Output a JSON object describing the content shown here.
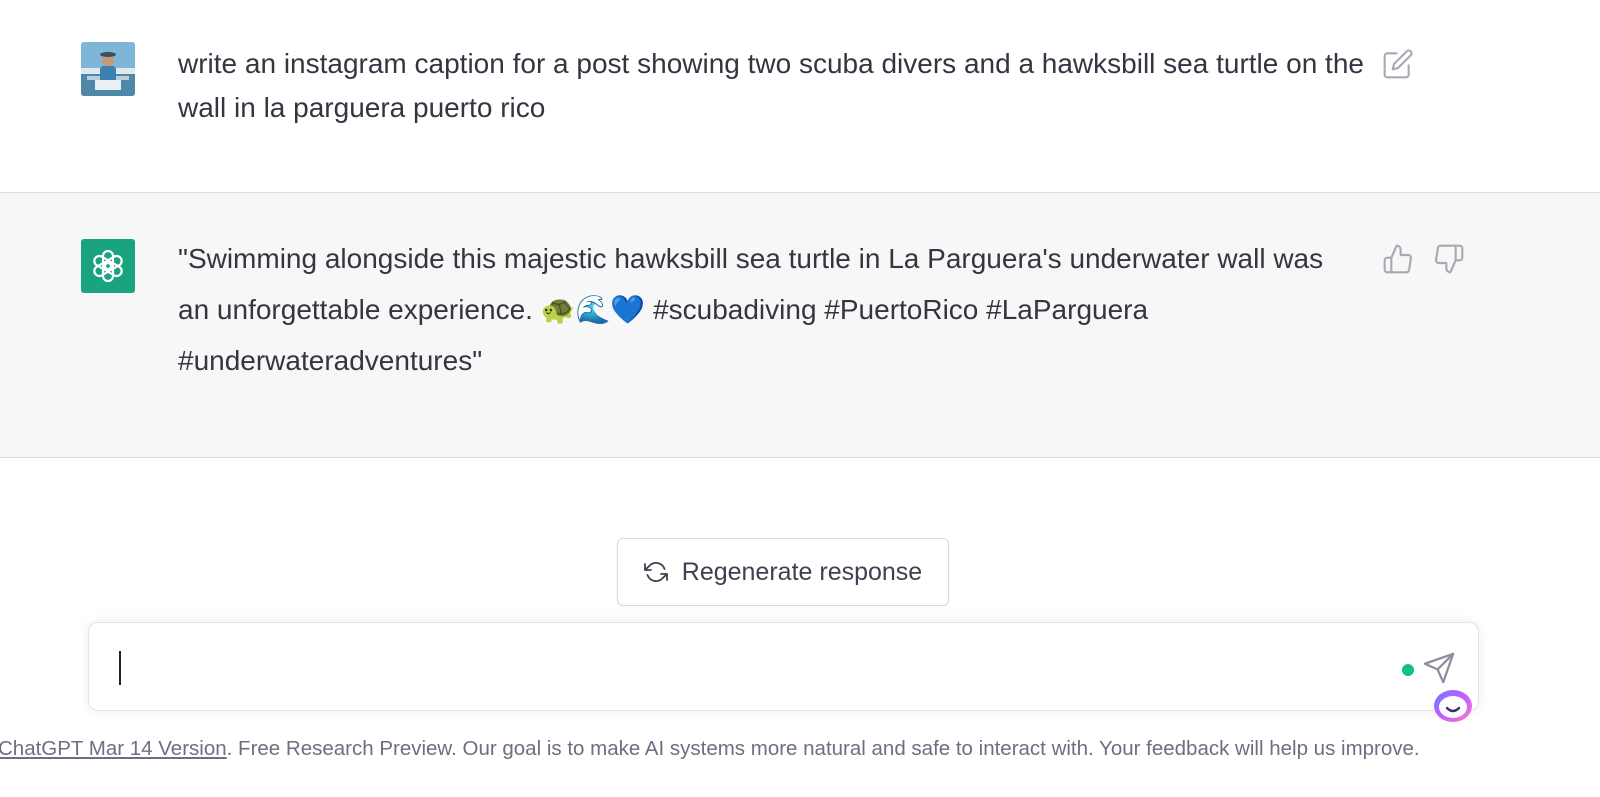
{
  "conversation": {
    "user_message": "write an instagram caption for a post showing two scuba divers and a hawksbill sea turtle on the wall in la parguera puerto rico",
    "assistant_message": "\"Swimming alongside this majestic hawksbill sea turtle in La Parguera's underwater wall was an unforgettable experience. 🐢🌊💙 #scubadiving #PuertoRico #LaParguera #underwateradventures\""
  },
  "icons": {
    "user_avatar": "user-avatar-photo",
    "assistant_avatar": "openai-logo-icon",
    "edit": "pencil-square-icon",
    "thumbs_up": "thumbs-up-icon",
    "thumbs_down": "thumbs-down-icon",
    "regenerate": "refresh-icon",
    "send": "paper-plane-icon",
    "extension": "assistant-extension-icon"
  },
  "actions": {
    "regenerate_label": "Regenerate response"
  },
  "composer": {
    "value": "",
    "placeholder": ""
  },
  "footer": {
    "version_link": "ChatGPT Mar 14 Version",
    "notice": ". Free Research Preview. Our goal is to make AI systems more natural and safe to interact with. Your feedback will help us improve."
  },
  "colors": {
    "accent": "#19a37f",
    "assistant_bg": "#f7f7f8",
    "status_dot": "#10c08a",
    "text": "#343541"
  }
}
